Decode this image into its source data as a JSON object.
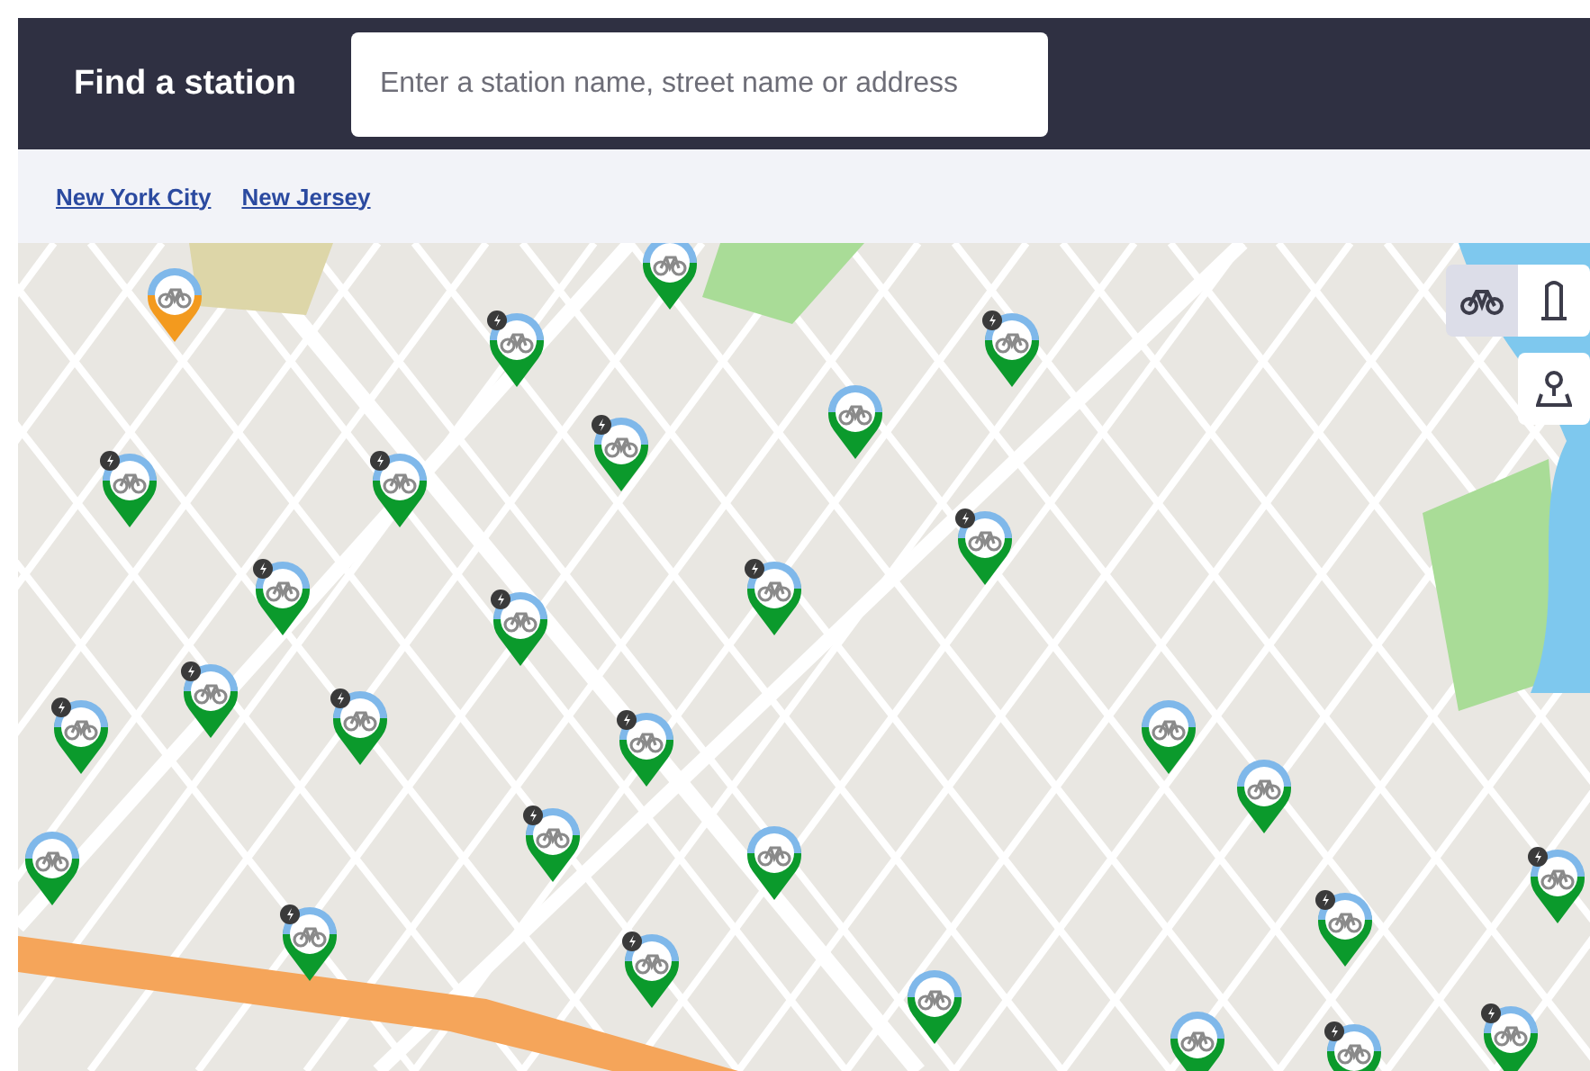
{
  "header": {
    "title": "Find a station",
    "search": {
      "placeholder": "Enter a station name, street name or address"
    }
  },
  "regions": [
    {
      "label": "New York City"
    },
    {
      "label": "New Jersey"
    }
  ],
  "map_controls": [
    {
      "kind": "bikes",
      "selected": true
    },
    {
      "kind": "docks",
      "selected": false
    }
  ],
  "locate_button": {
    "kind": "locate"
  },
  "stations": [
    {
      "color": "#f39a1e",
      "ebike": false
    },
    {
      "color": "#0b9a2c",
      "ebike": false
    },
    {
      "color": "#0b9a2c",
      "ebike": true
    },
    {
      "color": "#0b9a2c",
      "ebike": true
    },
    {
      "color": "#0b9a2c",
      "ebike": false
    },
    {
      "color": "#0b9a2c",
      "ebike": true
    },
    {
      "color": "#0b9a2c",
      "ebike": true
    },
    {
      "color": "#0b9a2c",
      "ebike": true
    },
    {
      "color": "#0b9a2c",
      "ebike": true
    },
    {
      "color": "#0b9a2c",
      "ebike": true
    },
    {
      "color": "#0b9a2c",
      "ebike": true
    },
    {
      "color": "#0b9a2c",
      "ebike": true
    },
    {
      "color": "#0b9a2c",
      "ebike": true
    },
    {
      "color": "#0b9a2c",
      "ebike": true
    },
    {
      "color": "#0b9a2c",
      "ebike": true
    },
    {
      "color": "#0b9a2c",
      "ebike": true
    },
    {
      "color": "#0b9a2c",
      "ebike": false
    },
    {
      "color": "#0b9a2c",
      "ebike": false
    },
    {
      "color": "#0b9a2c",
      "ebike": true
    },
    {
      "color": "#0b9a2c",
      "ebike": false
    },
    {
      "color": "#0b9a2c",
      "ebike": false
    },
    {
      "color": "#0b9a2c",
      "ebike": true
    },
    {
      "color": "#0b9a2c",
      "ebike": true
    },
    {
      "color": "#0b9a2c",
      "ebike": true
    },
    {
      "color": "#0b9a2c",
      "ebike": true
    },
    {
      "color": "#0b9a2c",
      "ebike": false
    },
    {
      "color": "#0b9a2c",
      "ebike": false
    },
    {
      "color": "#0b9a2c",
      "ebike": true
    },
    {
      "color": "#0b9a2c",
      "ebike": true
    }
  ]
}
